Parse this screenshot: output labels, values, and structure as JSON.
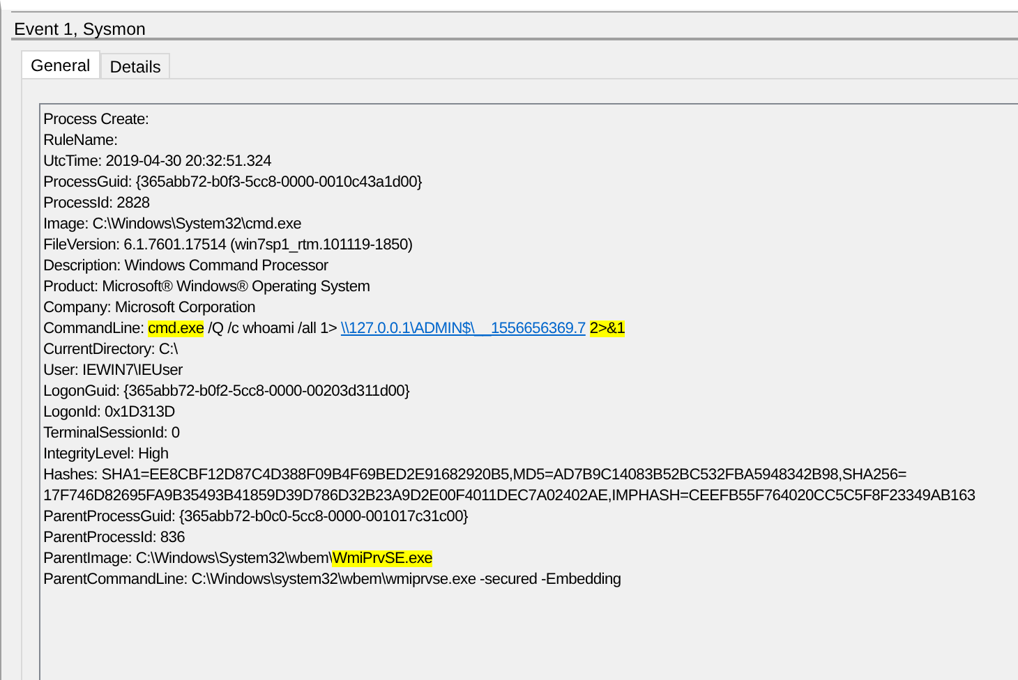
{
  "window": {
    "title": "Event 1, Sysmon"
  },
  "tabs": [
    {
      "label": "General",
      "selected": true
    },
    {
      "label": "Details",
      "selected": false
    }
  ],
  "lines": [
    [
      {
        "kind": "plain",
        "text": "Process Create:"
      }
    ],
    [
      {
        "kind": "plain",
        "text": "RuleName:"
      }
    ],
    [
      {
        "kind": "plain",
        "text": "UtcTime: 2019-04-30 20:32:51.324"
      }
    ],
    [
      {
        "kind": "plain",
        "text": "ProcessGuid: {365abb72-b0f3-5cc8-0000-0010c43a1d00}"
      }
    ],
    [
      {
        "kind": "plain",
        "text": "ProcessId: 2828"
      }
    ],
    [
      {
        "kind": "plain",
        "text": "Image: C:\\Windows\\System32\\cmd.exe"
      }
    ],
    [
      {
        "kind": "plain",
        "text": "FileVersion: 6.1.7601.17514 (win7sp1_rtm.101119-1850)"
      }
    ],
    [
      {
        "kind": "plain",
        "text": "Description: Windows Command Processor"
      }
    ],
    [
      {
        "kind": "plain",
        "text": "Product: Microsoft® Windows® Operating System"
      }
    ],
    [
      {
        "kind": "plain",
        "text": "Company: Microsoft Corporation"
      }
    ],
    [
      {
        "kind": "plain",
        "text": "CommandLine: "
      },
      {
        "kind": "highlight",
        "text": "cmd.exe"
      },
      {
        "kind": "plain",
        "text": " /Q /c whoami /all 1> "
      },
      {
        "kind": "link",
        "text": "\\\\127.0.0.1\\ADMIN$\\__1556656369.7"
      },
      {
        "kind": "highlight",
        "text": "2>&1"
      }
    ],
    [
      {
        "kind": "plain",
        "text": "CurrentDirectory: C:\\"
      }
    ],
    [
      {
        "kind": "plain",
        "text": "User: IEWIN7\\IEUser"
      }
    ],
    [
      {
        "kind": "plain",
        "text": "LogonGuid: {365abb72-b0f2-5cc8-0000-00203d311d00}"
      }
    ],
    [
      {
        "kind": "plain",
        "text": "LogonId: 0x1D313D"
      }
    ],
    [
      {
        "kind": "plain",
        "text": "TerminalSessionId: 0"
      }
    ],
    [
      {
        "kind": "plain",
        "text": "IntegrityLevel: High"
      }
    ],
    [
      {
        "kind": "plain",
        "text": "Hashes: SHA1=EE8CBF12D87C4D388F09B4F69BED2E91682920B5,MD5=AD7B9C14083B52BC532FBA5948342B98,SHA256="
      }
    ],
    [
      {
        "kind": "plain",
        "text": "17F746D82695FA9B35493B41859D39D786D32B23A9D2E00F4011DEC7A02402AE,IMPHASH=CEEFB55F764020CC5C5F8F23349AB163"
      }
    ],
    [
      {
        "kind": "plain",
        "text": "ParentProcessGuid: {365abb72-b0c0-5cc8-0000-001017c31c00}"
      }
    ],
    [
      {
        "kind": "plain",
        "text": "ParentProcessId: 836"
      }
    ],
    [
      {
        "kind": "plain",
        "text": "ParentImage: C:\\Windows\\System32\\wbem\\"
      },
      {
        "kind": "highlight",
        "text": "WmiPrvSE.exe"
      }
    ],
    [
      {
        "kind": "plain",
        "text": "ParentCommandLine: C:\\Windows\\system32\\wbem\\wmiprvse.exe -secured -Embedding"
      }
    ]
  ]
}
